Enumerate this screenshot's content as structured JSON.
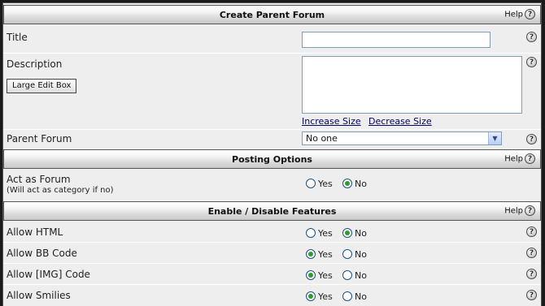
{
  "headers": {
    "create": {
      "title": "Create Parent Forum",
      "help": "Help"
    },
    "posting": {
      "title": "Posting Options",
      "help": "Help"
    },
    "features": {
      "title": "Enable / Disable Features",
      "help": "Help"
    }
  },
  "fields": {
    "title": {
      "label": "Title",
      "value": ""
    },
    "description": {
      "label": "Description",
      "value": "",
      "large_edit_button": "Large Edit Box",
      "increase": "Increase Size",
      "decrease": "Decrease Size"
    },
    "parent_forum": {
      "label": "Parent Forum",
      "selected": "No one"
    },
    "act_as_forum": {
      "label": "Act as Forum",
      "sublabel": "(Will act as category if no)",
      "selected": "No"
    },
    "allow_html": {
      "label": "Allow HTML",
      "selected": "No"
    },
    "allow_bbcode": {
      "label": "Allow BB Code",
      "selected": "Yes"
    },
    "allow_img": {
      "label": "Allow [IMG] Code",
      "selected": "Yes"
    },
    "allow_smilies": {
      "label": "Allow Smilies",
      "selected": "Yes"
    }
  },
  "radio": {
    "yes": "Yes",
    "no": "No"
  },
  "icons": {
    "help": "help-question-icon"
  },
  "colors": {
    "radio_checked": "#2e9b2e",
    "link": "#000066",
    "header_bg": "#dcdcdc"
  }
}
